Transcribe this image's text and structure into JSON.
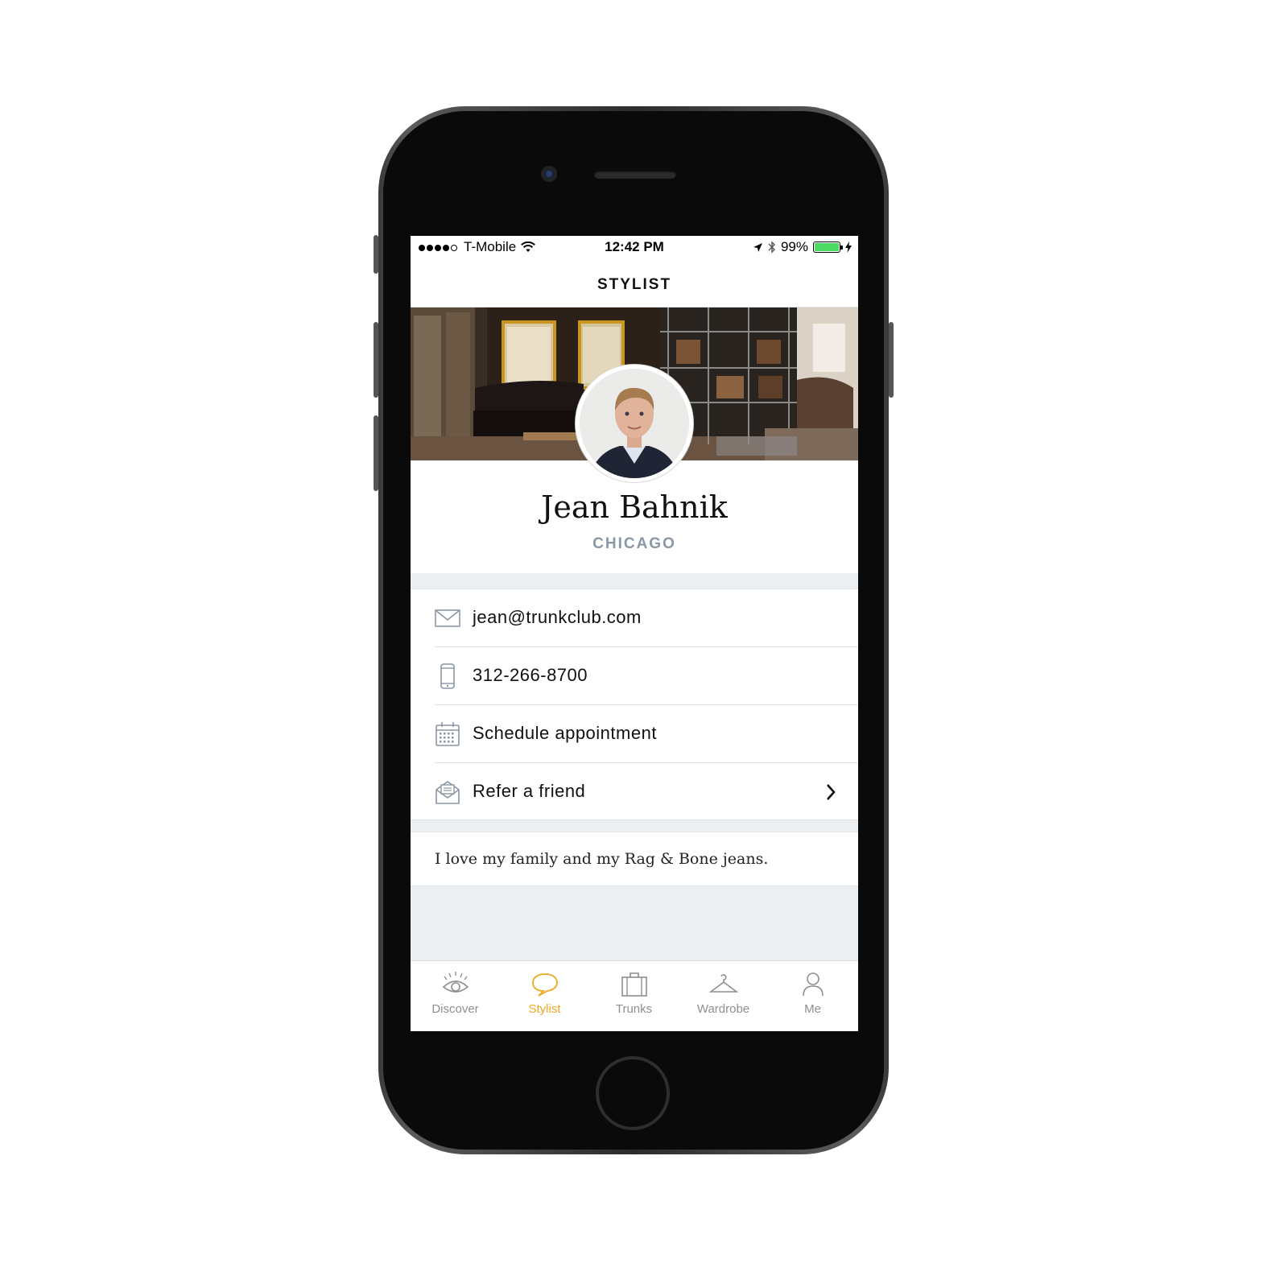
{
  "status_bar": {
    "carrier": "T-Mobile",
    "time": "12:42 PM",
    "battery_percent": "99%",
    "battery_level": 0.99
  },
  "nav": {
    "title": "STYLIST"
  },
  "profile": {
    "name": "Jean Bahnik",
    "city": "CHICAGO"
  },
  "contact": [
    {
      "icon": "envelope-icon",
      "label": "jean@trunkclub.com"
    },
    {
      "icon": "phone-icon",
      "label": "312-266-8700"
    },
    {
      "icon": "calendar-icon",
      "label": "Schedule appointment"
    },
    {
      "icon": "envelope-open-icon",
      "label": "Refer a friend"
    }
  ],
  "bio": "I love my family and my Rag & Bone jeans.",
  "tabs": [
    {
      "icon": "eye-icon",
      "label": "Discover",
      "active": false
    },
    {
      "icon": "speech-bubble-icon",
      "label": "Stylist",
      "active": true
    },
    {
      "icon": "suitcase-icon",
      "label": "Trunks",
      "active": false
    },
    {
      "icon": "hanger-icon",
      "label": "Wardrobe",
      "active": false
    },
    {
      "icon": "person-icon",
      "label": "Me",
      "active": false
    }
  ],
  "colors": {
    "accent": "#f0a823",
    "inactive": "#8e8e93",
    "city": "#8a97a6",
    "battery": "#4cd964"
  }
}
